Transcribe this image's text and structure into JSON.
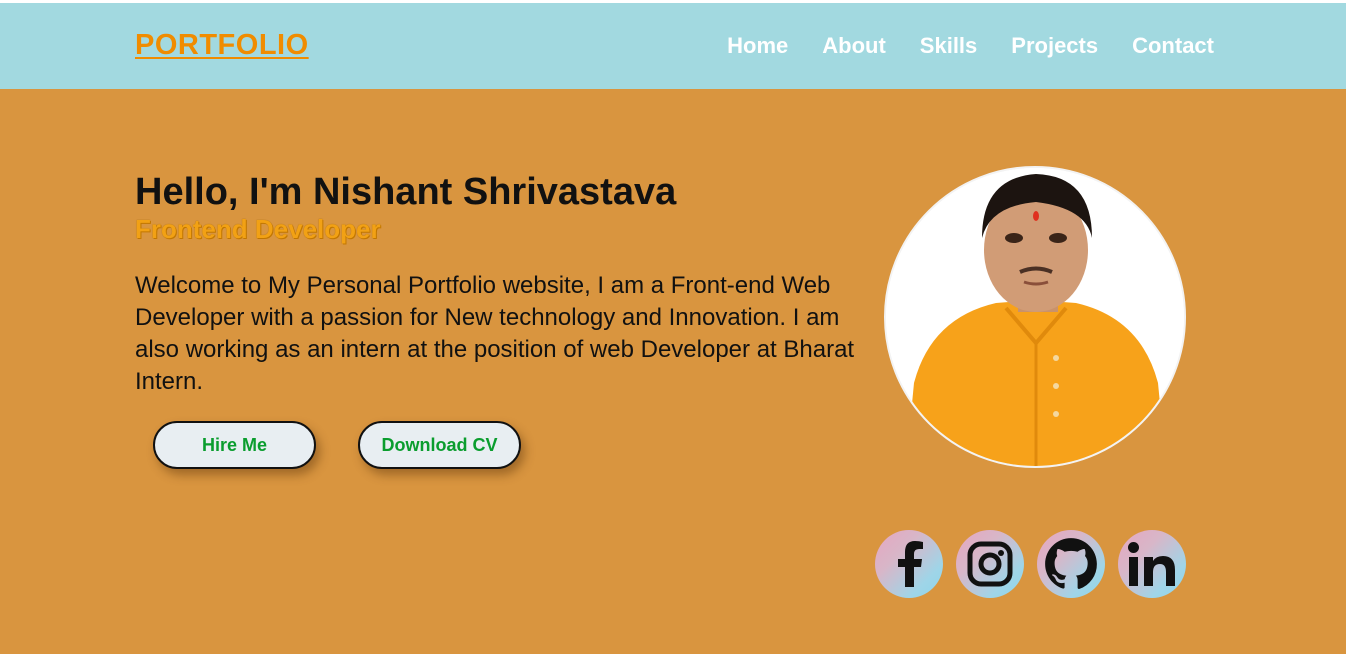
{
  "nav": {
    "logo": "PORTFOLIO",
    "links": [
      "Home",
      "About",
      "Skills",
      "Projects",
      "Contact"
    ]
  },
  "hero": {
    "greeting": "Hello, I'm Nishant Shrivastava",
    "role": "Frontend Developer",
    "intro": "Welcome to My Personal Portfolio website, I am a Front-end Web Developer with a passion for New technology and Innovation. I am also working as an intern at the position of web Developer at Bharat Intern.",
    "buttons": {
      "hire": "Hire Me",
      "cv": "Download CV"
    }
  },
  "profile_photo": "portrait-photo",
  "socials": [
    "facebook-icon",
    "instagram-icon",
    "github-icon",
    "linkedin-icon"
  ],
  "colors": {
    "background": "#d9953f",
    "navbar": "#a2d9e0",
    "accent": "#f08c00",
    "button_text": "#0a9d2e"
  }
}
